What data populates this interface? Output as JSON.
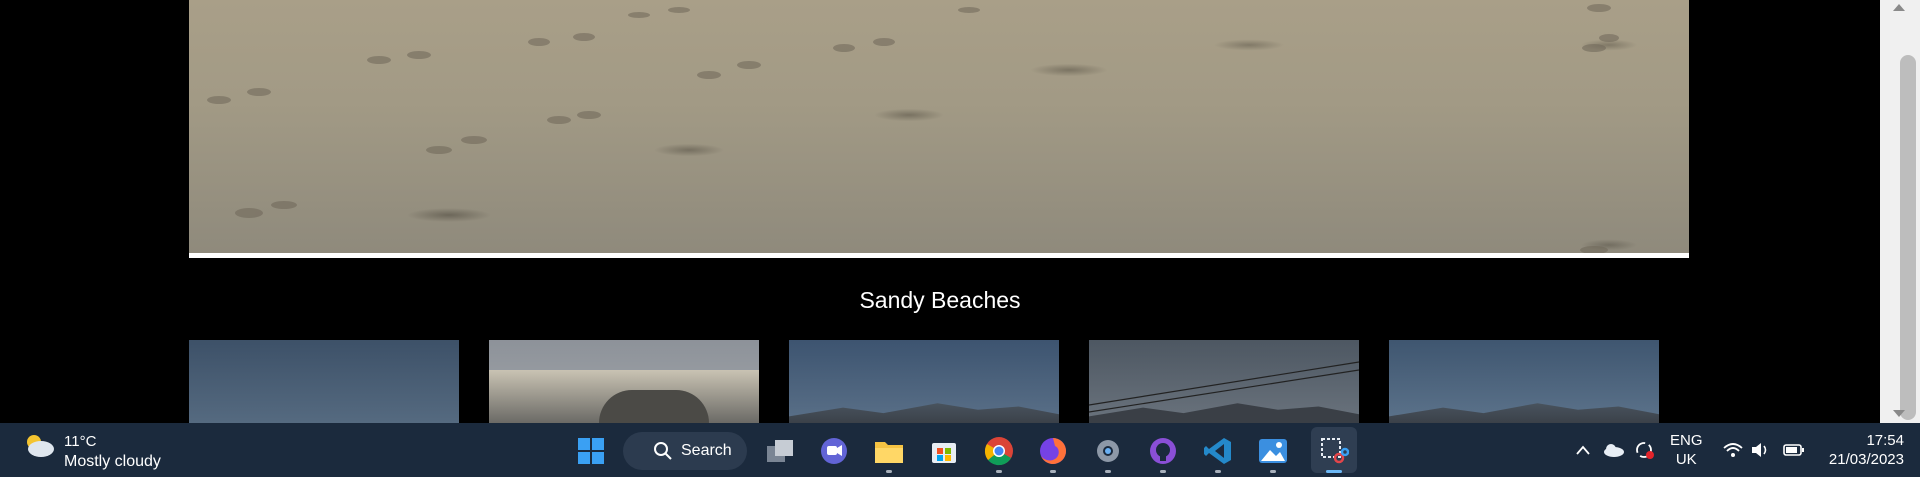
{
  "page": {
    "section_title": "Sandy Beaches"
  },
  "gallery": {
    "hero_image": "Footprints in sand photo",
    "thumbnails": [
      {
        "name": "beach-sky-thumbnail"
      },
      {
        "name": "village-bridge-thumbnail"
      },
      {
        "name": "mountain-thumbnail"
      },
      {
        "name": "mountain-powerlines-thumbnail"
      },
      {
        "name": "coast-mountain-thumbnail"
      }
    ]
  },
  "taskbar": {
    "weather": {
      "temp": "11°C",
      "desc": "Mostly cloudy"
    },
    "search_label": "Search",
    "apps": [
      "start-icon",
      "task-view-icon",
      "chat-icon",
      "file-explorer-icon",
      "store-icon",
      "chrome-icon",
      "firefox-icon",
      "settings-icon",
      "github-icon",
      "vscode-icon",
      "photos-icon",
      "snipping-tool-icon"
    ],
    "lang": {
      "line1": "ENG",
      "line2": "UK"
    },
    "clock": {
      "time": "17:54",
      "date": "21/03/2023"
    }
  },
  "colors": {
    "taskbar": "#1b2a3d",
    "accent": "#6cb8f6"
  }
}
